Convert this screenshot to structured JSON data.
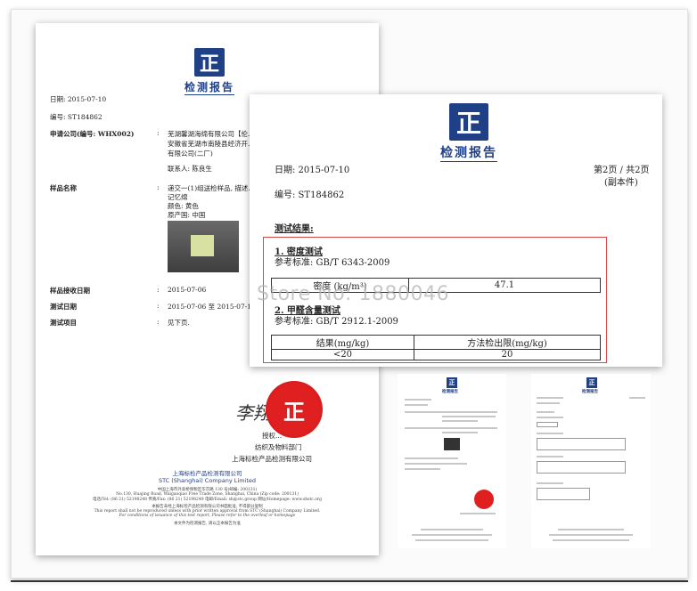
{
  "logo": {
    "mark": "正",
    "title": "检测报告"
  },
  "page1": {
    "date": "日期: 2015-07-10",
    "number": "编号: ST184862",
    "applicant_label": "申请公司(编号: WHX002)",
    "applicant_lines": [
      "芜湖馨湖海绵有限公司【伦...",
      "安徽省芜湖市南陵县经济开...",
      "有限公司(二厂)"
    ],
    "contact": "联系人: 陈良生",
    "sample_label": "样品名称",
    "sample_lines": [
      "递交一(1)组送检样品, 描述...",
      "记忆绵",
      "颜色: 黄色",
      "原产国: 中国"
    ],
    "received_label": "样品接收日期",
    "received_value": "2015-07-06",
    "test_date_label": "测试日期",
    "test_date_value": "2015-07-06  至  2015-07-10",
    "test_items_label": "测试项目",
    "test_items_value": "见下页.",
    "colon": ":",
    "signature": "李翔",
    "seal_text": "正",
    "auth": "授权...",
    "dept": "纺织及物料部门",
    "company_cn_sign": "上海标检产品检测有限公司",
    "footer_cn": "上海标检产品检测有限公司",
    "footer_en": "STC (Shanghai) Company Limited",
    "footer_small": [
      "中国上海市外高桥保税区华京路 130 号(邮编: 200131)",
      "No.130, Huajing Road, Waigaoqiao Free Trade Zone, Shanghai, China (Zip code: 200131)",
      "电话/Tel: (86 21) 52198248 传真/Fax: (86 21) 52198249 电邮/Email: sh@stc.group  网址/Homepage: www.shstc.org",
      "本报告未经上海标检产品检测有限公司书面批准, 不得部分复制",
      "This report shall not be reproduced unless with prior written approval from STC (Shanghai) Company Limited.",
      "For conditions of issuance of this test report, Please refer to the overleaf or homepage",
      "本文件为检测报告, 请以正本报告为准"
    ]
  },
  "page2": {
    "date": "日期: 2015-07-10",
    "number": "编号: ST184862",
    "page_info": "第2页 / 共2页",
    "copy_info": "(副本件)",
    "results_title": "测试结果:",
    "test1_title": "1. 密度测试",
    "test1_ref": "参考标准: GB/T 6343-2009",
    "density_label": "密度 (kg/m³)",
    "density_value": "47.1",
    "test2_title": "2. 甲醛含量测试",
    "test2_ref": "参考标准: GB/T 2912.1-2009",
    "formaldehyde_headers": [
      "结果(mg/kg)",
      "方法检出限(mg/kg)"
    ],
    "formaldehyde_values": [
      "<20",
      "20"
    ]
  },
  "watermark": "Store No: 1880046",
  "thumbs": {
    "title": "检测报告"
  },
  "colors": {
    "brand": "#1f3f86",
    "seal": "#e02020",
    "highlight": "#d34a4a"
  }
}
